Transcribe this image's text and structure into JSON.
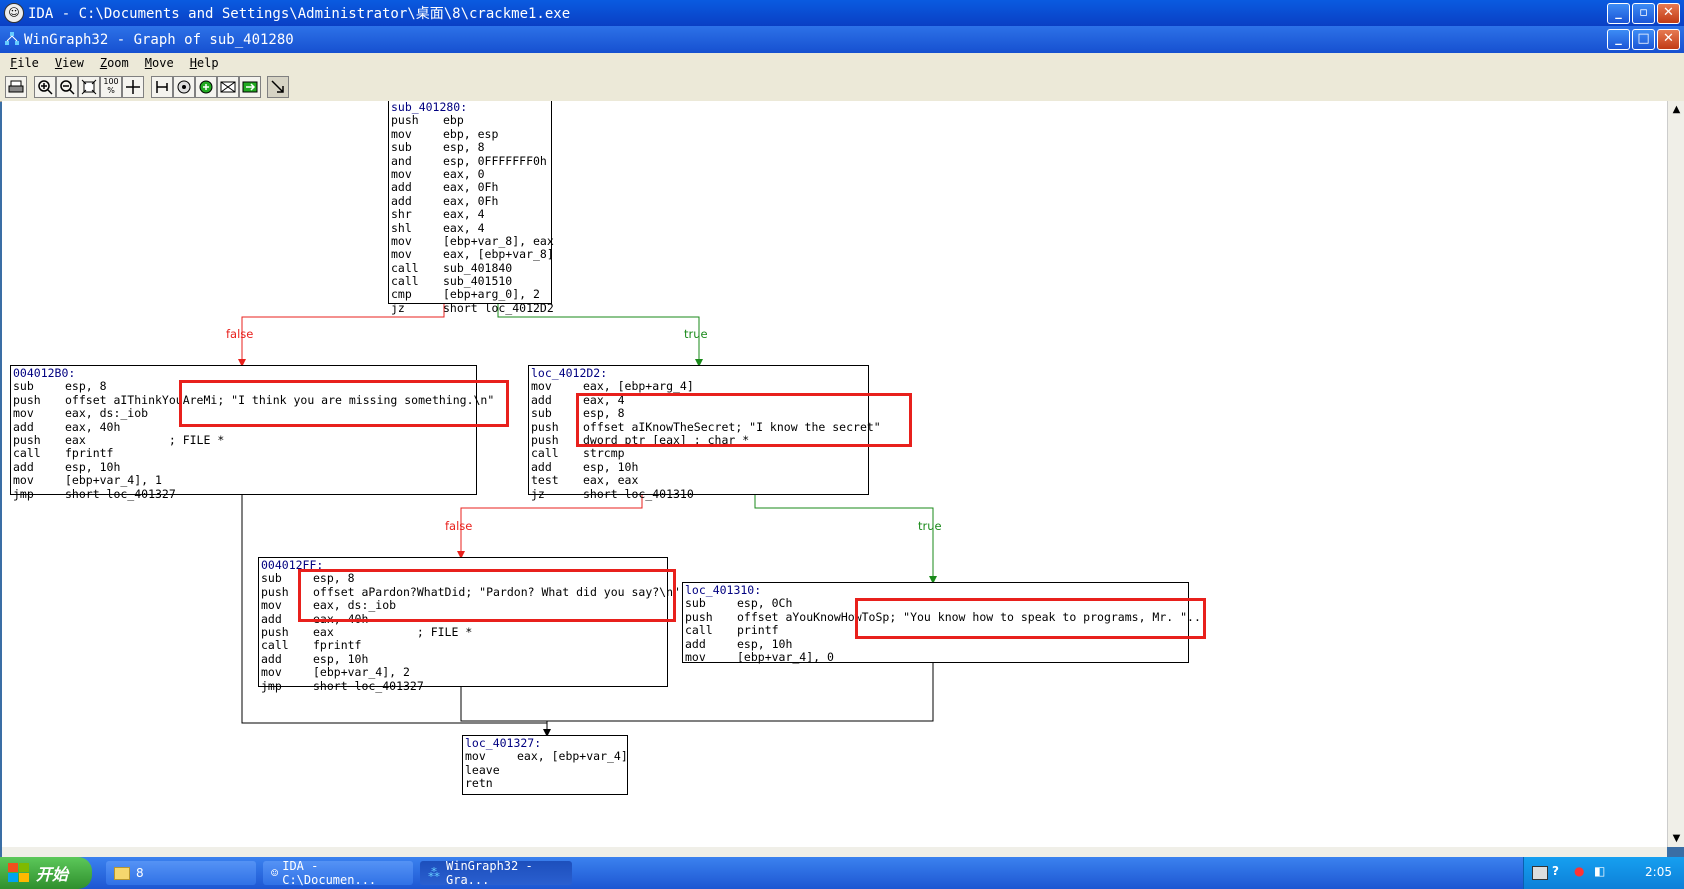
{
  "ida_window": {
    "title": "IDA - C:\\Documents and Settings\\Administrator\\桌面\\8\\crackme1.exe"
  },
  "graph_window": {
    "title": "WinGraph32 - Graph of sub_401280"
  },
  "window_controls": {
    "minimize": "_",
    "maximize": "□",
    "restore": "▫",
    "close": "✕"
  },
  "menu": [
    {
      "accel": "F",
      "rest": "ile"
    },
    {
      "accel": "V",
      "rest": "iew"
    },
    {
      "accel": "Z",
      "rest": "oom"
    },
    {
      "accel": "M",
      "rest": "ove"
    },
    {
      "accel": "H",
      "rest": "elp"
    }
  ],
  "toolbar": {
    "print_icon": "print-icon",
    "zoom_in_icon": "zoom-in-icon",
    "zoom_out_icon": "zoom-out-icon",
    "fit_icon": "fit-window-icon",
    "zoom_100_label": "100 %",
    "move_icon": "move-icon",
    "tools": [
      "layout-icon",
      "nodes-icon",
      "colors-icon",
      "frame-icon",
      "next-icon",
      "cursor-icon"
    ]
  },
  "edges": {
    "false_label": "false",
    "true_label": "true"
  },
  "nodes": {
    "n1": {
      "label": "sub_401280:",
      "lines": [
        [
          "push",
          "ebp"
        ],
        [
          "mov",
          "ebp, esp"
        ],
        [
          "sub",
          "esp, 8"
        ],
        [
          "and",
          "esp, 0FFFFFFF0h"
        ],
        [
          "mov",
          "eax, 0"
        ],
        [
          "add",
          "eax, 0Fh"
        ],
        [
          "add",
          "eax, 0Fh"
        ],
        [
          "shr",
          "eax, 4"
        ],
        [
          "shl",
          "eax, 4"
        ],
        [
          "mov",
          "[ebp+var_8], eax"
        ],
        [
          "mov",
          "eax, [ebp+var_8]"
        ],
        [
          "call",
          "sub_401840"
        ],
        [
          "call",
          "sub_401510"
        ],
        [
          "cmp",
          "[ebp+arg_0], 2"
        ],
        [
          "jz",
          "short loc_4012D2"
        ]
      ]
    },
    "n2": {
      "label": "004012B0:",
      "lines": [
        [
          "sub",
          "esp, 8"
        ],
        [
          "push",
          "offset aIThinkYouAreMi; \"I think you are missing something.\\n\""
        ],
        [
          "mov",
          "eax, ds:_iob"
        ],
        [
          "add",
          "eax, 40h"
        ],
        [
          "push",
          "eax            ; FILE *"
        ],
        [
          "call",
          "fprintf"
        ],
        [
          "add",
          "esp, 10h"
        ],
        [
          "mov",
          "[ebp+var_4], 1"
        ],
        [
          "jmp",
          "short loc_401327"
        ]
      ]
    },
    "n3": {
      "label": "loc_4012D2:",
      "lines": [
        [
          "mov",
          "eax, [ebp+arg_4]"
        ],
        [
          "add",
          "eax, 4"
        ],
        [
          "sub",
          "esp, 8"
        ],
        [
          "push",
          "offset aIKnowTheSecret; \"I know the secret\""
        ],
        [
          "push",
          "dword ptr [eax] ; char *"
        ],
        [
          "call",
          "strcmp"
        ],
        [
          "add",
          "esp, 10h"
        ],
        [
          "test",
          "eax, eax"
        ],
        [
          "jz",
          "short loc_401310"
        ]
      ]
    },
    "n4": {
      "label": "004012FF:",
      "lines": [
        [
          "sub",
          "esp, 8"
        ],
        [
          "push",
          "offset aPardon?WhatDid; \"Pardon? What did you say?\\n\""
        ],
        [
          "mov",
          "eax, ds:_iob"
        ],
        [
          "add",
          "eax, 40h"
        ],
        [
          "push",
          "eax            ; FILE *"
        ],
        [
          "call",
          "fprintf"
        ],
        [
          "add",
          "esp, 10h"
        ],
        [
          "mov",
          "[ebp+var_4], 2"
        ],
        [
          "jmp",
          "short loc_401327"
        ]
      ]
    },
    "n5": {
      "label": "loc_401310:",
      "lines": [
        [
          "sub",
          "esp, 0Ch"
        ],
        [
          "push",
          "offset aYouKnowHowToSp; \"You know how to speak to programs, Mr. \"..."
        ],
        [
          "call",
          "printf"
        ],
        [
          "add",
          "esp, 10h"
        ],
        [
          "mov",
          "[ebp+var_4], 0"
        ]
      ]
    },
    "n6": {
      "label": "loc_401327:",
      "lines": [
        [
          "mov",
          "eax, [ebp+var_4]"
        ],
        [
          "leave",
          ""
        ],
        [
          "retn",
          ""
        ]
      ]
    }
  },
  "colors": {
    "false_edge": "#e8201c",
    "true_edge": "#1a8a1a",
    "highlight": "#e8201c",
    "label_text": "#000080"
  },
  "taskbar": {
    "start_label": "开始",
    "folder_task": "8",
    "ida_task": "IDA - C:\\Documen...",
    "wingraph_task": "WinGraph32 - Gra...",
    "clock": "2:05"
  }
}
